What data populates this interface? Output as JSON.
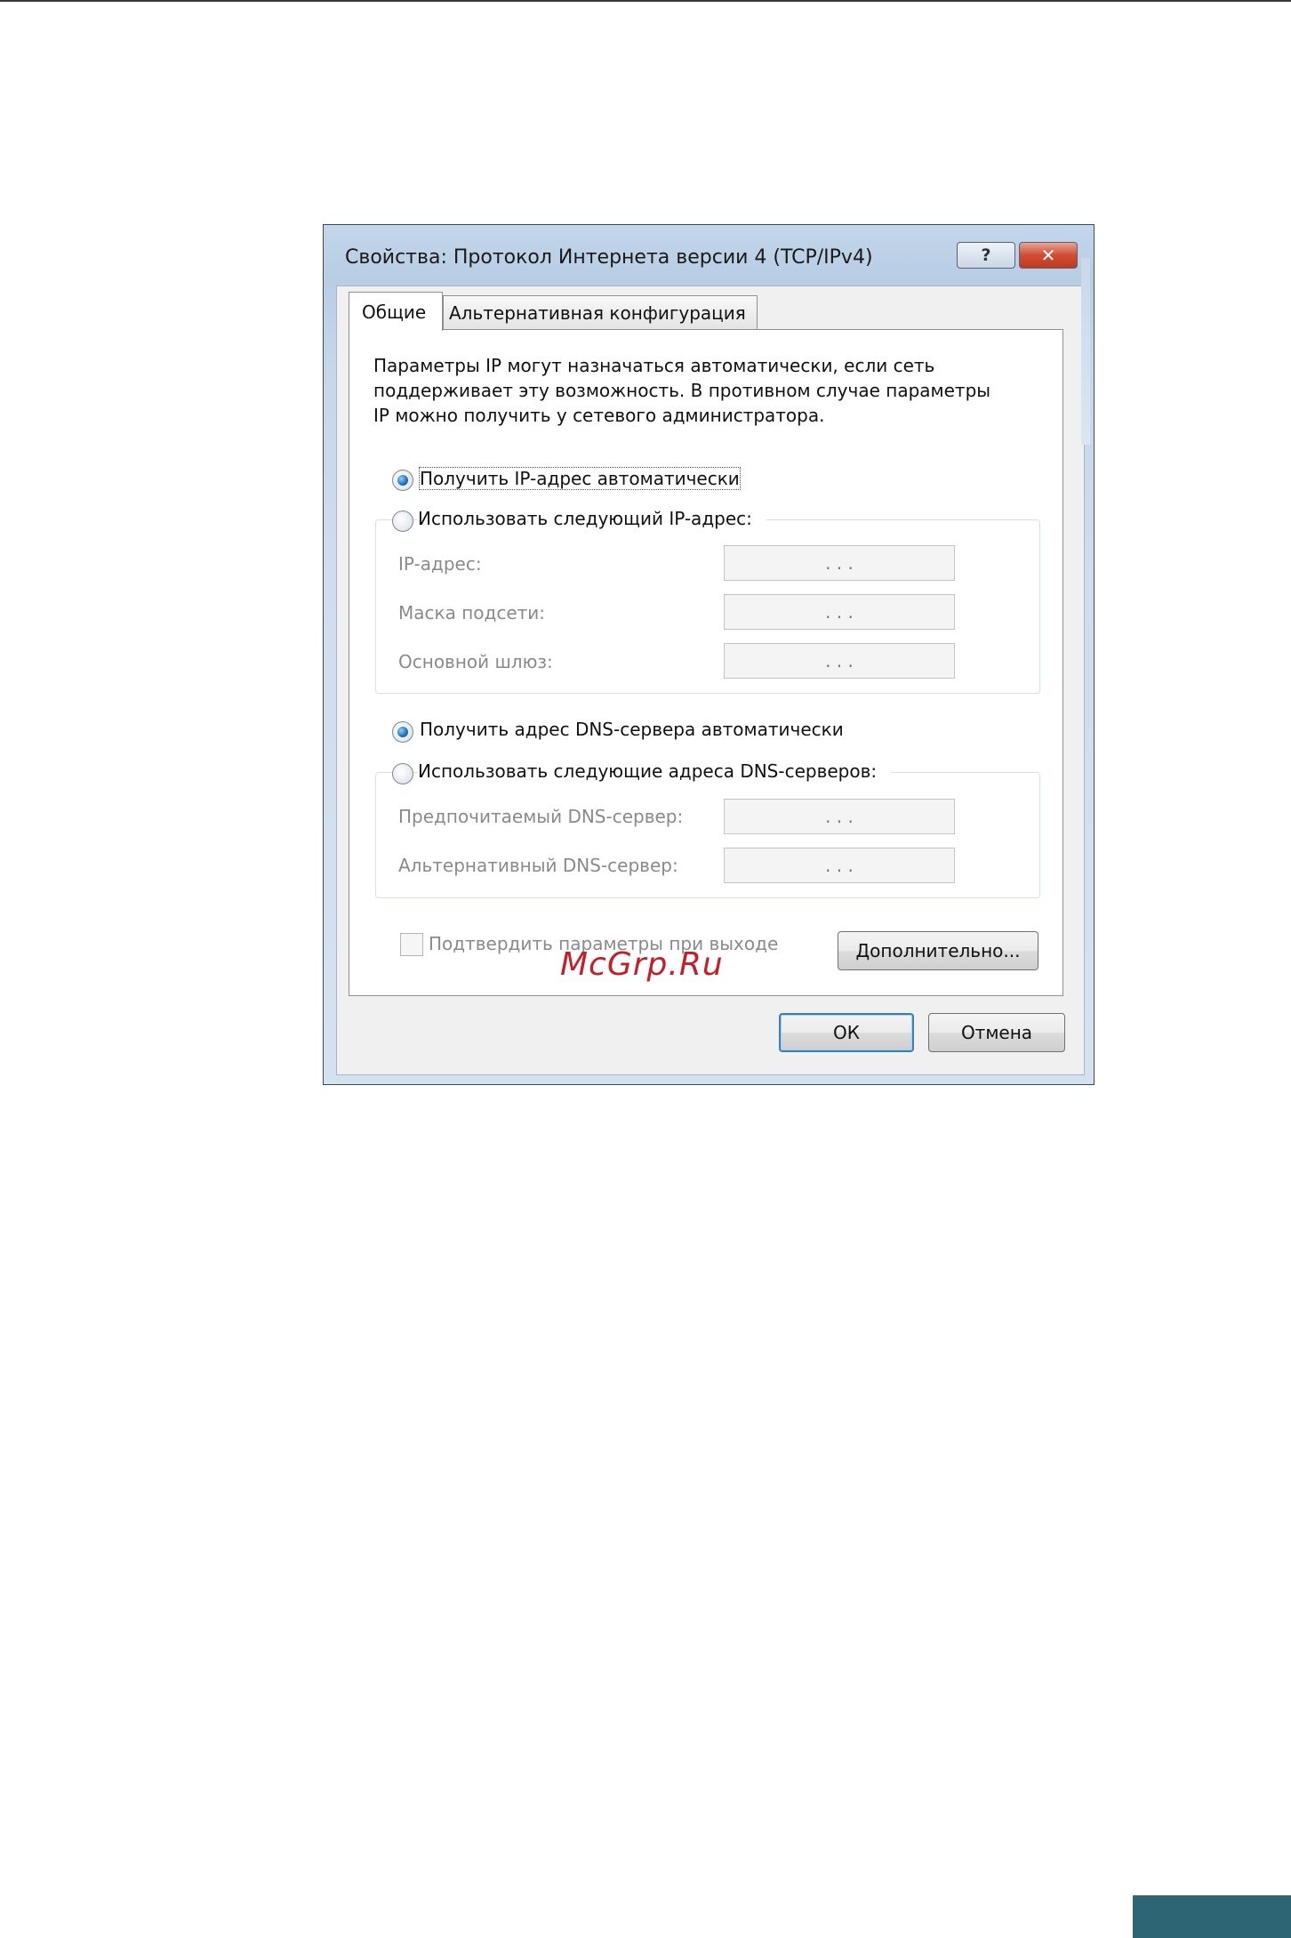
{
  "dialog": {
    "title": "Свойства: Протокол Интернета версии 4 (TCP/IPv4)",
    "help_label": "?",
    "close_label": "✕"
  },
  "tabs": [
    {
      "label": "Общие",
      "active": true
    },
    {
      "label": "Альтернативная конфигурация",
      "active": false
    }
  ],
  "description": [
    "Параметры IP могут назначаться автоматически, если сеть",
    "поддерживает эту возможность. В противном случае параметры",
    "IP можно получить у сетевого администратора."
  ],
  "ip": {
    "auto_label": "Получить IP-адрес автоматически",
    "auto_selected": true,
    "manual_label": "Использовать следующий IP-адрес:",
    "manual_selected": false,
    "fields": [
      {
        "label": "IP-адрес:",
        "value": ".   .   ."
      },
      {
        "label": "Маска подсети:",
        "value": ".   .   ."
      },
      {
        "label": "Основной шлюз:",
        "value": ".   .   ."
      }
    ]
  },
  "dns": {
    "auto_label": "Получить адрес DNS-сервера автоматически",
    "auto_selected": true,
    "manual_label": "Использовать следующие адреса DNS-серверов:",
    "manual_selected": false,
    "fields": [
      {
        "label": "Предпочитаемый DNS-сервер:",
        "value": ".   .   ."
      },
      {
        "label": "Альтернативный DNS-сервер:",
        "value": ".   .   ."
      }
    ]
  },
  "validate_checkbox": {
    "label": "Подтвердить параметры при выходе",
    "checked": false
  },
  "buttons": {
    "advanced": "Дополнительно...",
    "ok": "ОК",
    "cancel": "Отмена"
  },
  "watermark": "McGrp.Ru",
  "colors": {
    "titlebar": "#c3d6ea",
    "close_button": "#cf4d33",
    "radio_dot": "#1c6fb8",
    "page_tab": "#2e6574",
    "watermark": "#c0202a"
  }
}
